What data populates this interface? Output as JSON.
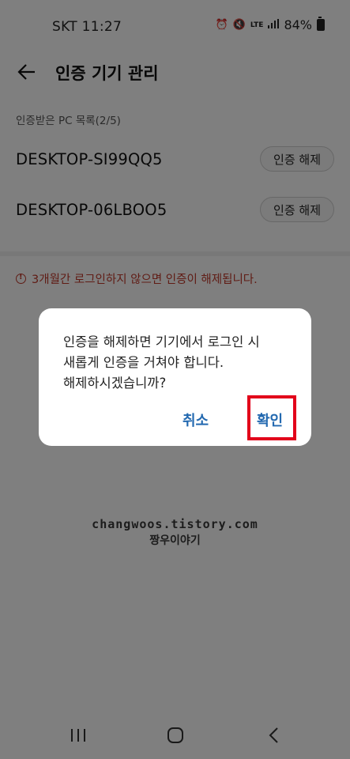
{
  "status_bar": {
    "carrier": "SKT",
    "time": "11:27",
    "lte": "LTE",
    "battery": "84%",
    "icons": [
      "alarm-icon",
      "mute-icon",
      "lte-icon",
      "signal-icon",
      "battery-icon"
    ]
  },
  "header": {
    "title": "인증 기기 관리",
    "back_icon": "arrow-left-icon"
  },
  "section": {
    "label": "인증받은 PC 목록(2/5)"
  },
  "devices": [
    {
      "name": "DESKTOP-SI99QQ5",
      "action": "인증 해제"
    },
    {
      "name": "DESKTOP-06LBOO5",
      "action": "인증 해제"
    }
  ],
  "warning": {
    "text": "3개월간 로그인하지 않으면 인증이 해제됩니다.",
    "icon": "warning-icon",
    "color": "#c0392b"
  },
  "dialog": {
    "message_lines": [
      "인증을 해제하면 기기에서 로그인 시",
      "새롭게 인증을 거쳐야 합니다.",
      "해제하시겠습니까?"
    ],
    "cancel": "취소",
    "confirm": "확인",
    "button_color": "#2369b0",
    "highlight_color": "#e2001a"
  },
  "watermark": {
    "line1": "changwoos.tistory.com",
    "line2": "짱우이야기"
  },
  "nav_bar": {
    "icons": [
      "recent-apps-icon",
      "home-icon",
      "back-icon"
    ]
  }
}
